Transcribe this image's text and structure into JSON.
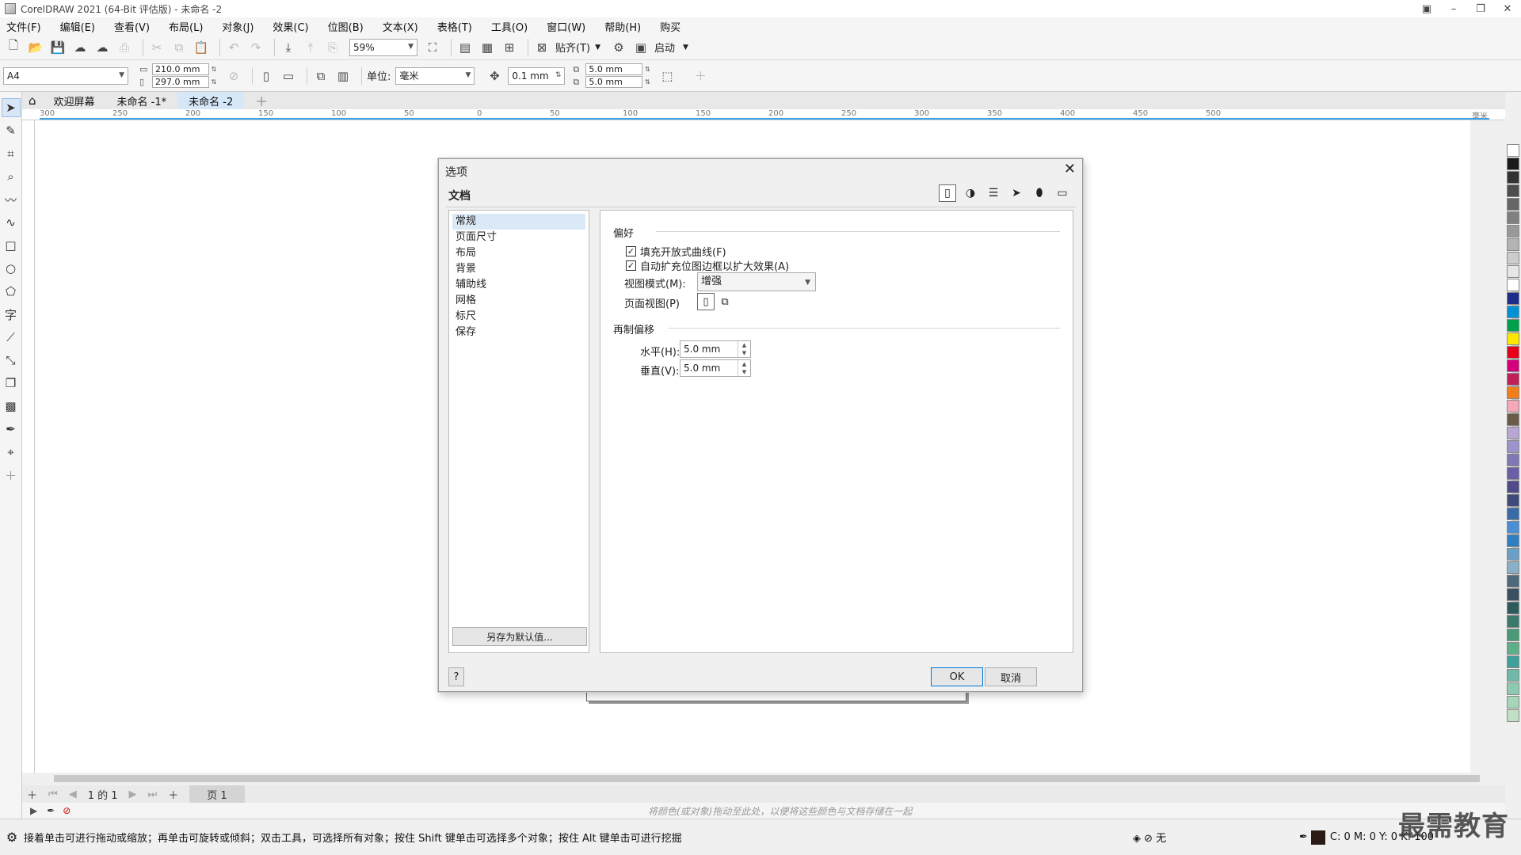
{
  "window": {
    "title": "CorelDRAW 2021 (64-Bit 评估版) - 未命名 -2"
  },
  "menu": [
    "文件(F)",
    "编辑(E)",
    "查看(V)",
    "布局(L)",
    "对象(J)",
    "效果(C)",
    "位图(B)",
    "文本(X)",
    "表格(T)",
    "工具(O)",
    "窗口(W)",
    "帮助(H)",
    "购买"
  ],
  "toolbar": {
    "zoom": "59%",
    "snap_label": "贴齐(T)",
    "launch_label": "启动"
  },
  "propbar": {
    "page_size": "A4",
    "width": "210.0 mm",
    "height": "297.0 mm",
    "unit_label": "单位:",
    "unit_value": "毫米",
    "nudge": "0.1 mm",
    "dup_h": "5.0 mm",
    "dup_v": "5.0 mm"
  },
  "doc_tabs": [
    "欢迎屏幕",
    "未命名 -1*",
    "未命名 -2"
  ],
  "ruler_ticks": [
    "300",
    "250",
    "200",
    "150",
    "100",
    "50",
    "0",
    "50",
    "100",
    "150",
    "200",
    "250",
    "300",
    "350",
    "400",
    "450",
    "500"
  ],
  "ruler_unit": "毫米",
  "dialog": {
    "title": "选项",
    "section": "文档",
    "categories": [
      "常规",
      "页面尺寸",
      "布局",
      "背景",
      "辅助线",
      "网格",
      "标尺",
      "保存"
    ],
    "save_default_label": "另存为默认值...",
    "prefs_group": "偏好",
    "fill_open_curves": "填充开放式曲线(F)",
    "auto_inflate": "自动扩充位图边框以扩大效果(A)",
    "view_mode_label": "视图模式(M):",
    "view_mode_value": "增强",
    "page_view_label": "页面视图(P)",
    "dup_group": "再制偏移",
    "horizontal_label": "水平(H):",
    "horizontal_value": "5.0 mm",
    "vertical_label": "垂直(V):",
    "vertical_value": "5.0 mm",
    "help_label": "?",
    "ok_label": "OK",
    "cancel_label": "取消"
  },
  "pagenav": {
    "page_count": "1 的 1",
    "page_tab": "页 1"
  },
  "hint": "将颜色(或对象)拖动至此处，以便将这些颜色与文档存储在一起",
  "status": {
    "message": "接着单击可进行拖动或缩放；再单击可旋转或倾斜；双击工具，可选择所有对象；按住 Shift 键单击可选择多个对象；按住 Alt 键单击可进行挖掘",
    "fill_none": "无",
    "cmyk": "C: 0 M: 0 Y: 0 K: 100"
  },
  "watermark": "最需教育",
  "palette": [
    "#ffffff",
    "#1a1a1a",
    "#333333",
    "#4d4d4d",
    "#666666",
    "#808080",
    "#999999",
    "#b3b3b3",
    "#cccccc",
    "#e6e6e6",
    "#ffffff",
    "#1f2d8a",
    "#0091d5",
    "#00a04a",
    "#ffe600",
    "#e6001a",
    "#d4007a",
    "#c01f5a",
    "#f07f1a",
    "#f5a8b8",
    "#6b5a4a",
    "#b8a6d4",
    "#9b93c9",
    "#7f78b6",
    "#6a5fa6",
    "#4f4a88",
    "#3e4a7a",
    "#3a6aa8",
    "#4a8ed6",
    "#2f7fc1",
    "#6b9fc6",
    "#8ab0c8",
    "#4d6878",
    "#3a5060",
    "#2e5a5a",
    "#3a7a6a",
    "#4a9a7a",
    "#5fae8a",
    "#3fa09a",
    "#6fb9a8",
    "#8fc9b0",
    "#a6d6b8",
    "#bfe0c4"
  ]
}
